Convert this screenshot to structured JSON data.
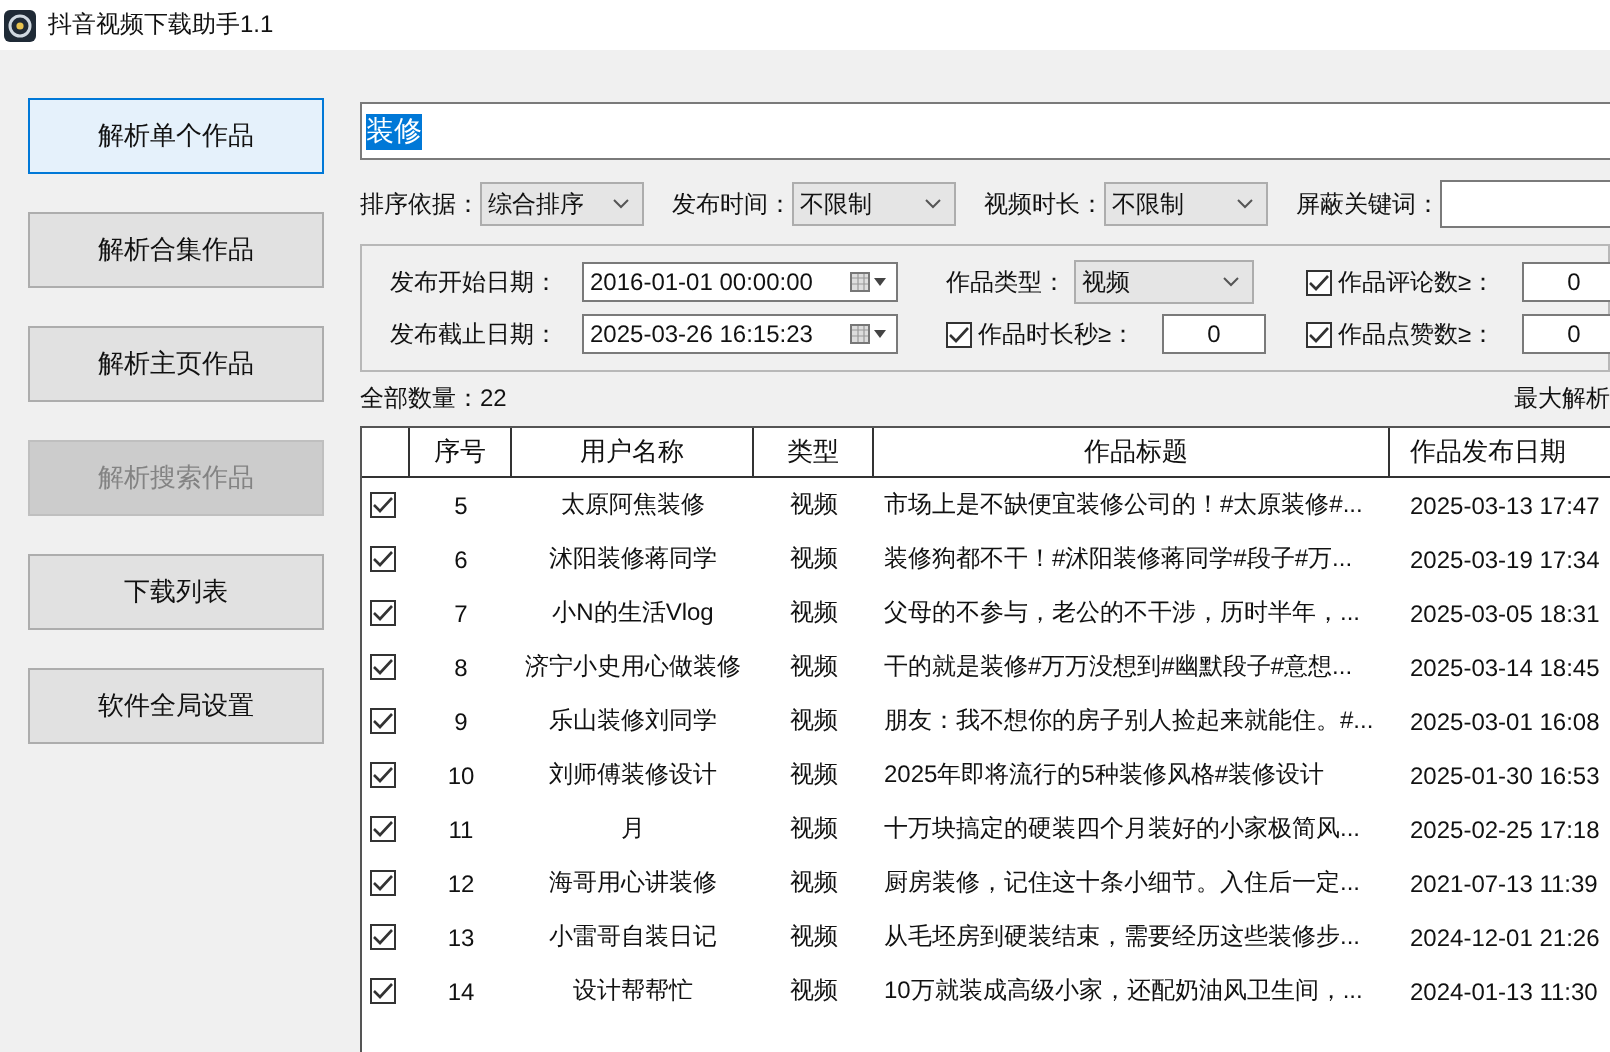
{
  "window": {
    "title": "抖音视频下载助手1.1"
  },
  "sidebar": {
    "items": [
      {
        "label": "解析单个作品",
        "selected": true,
        "disabled": false
      },
      {
        "label": "解析合集作品",
        "selected": false,
        "disabled": false
      },
      {
        "label": "解析主页作品",
        "selected": false,
        "disabled": false
      },
      {
        "label": "解析搜索作品",
        "selected": false,
        "disabled": true
      },
      {
        "label": "下载列表",
        "selected": false,
        "disabled": false
      },
      {
        "label": "软件全局设置",
        "selected": false,
        "disabled": false
      }
    ]
  },
  "search": {
    "value": "装修"
  },
  "filters": [
    {
      "label": "排序依据：",
      "value": "综合排序"
    },
    {
      "label": "发布时间：",
      "value": "不限制"
    },
    {
      "label": "视频时长：",
      "value": "不限制"
    }
  ],
  "blocked_keywords": {
    "label": "屏蔽关键词："
  },
  "date_range": {
    "start": {
      "label": "发布开始日期：",
      "value": "2016-01-01 00:00:00"
    },
    "end": {
      "label": "发布截止日期：",
      "value": "2025-03-26 16:15:23"
    }
  },
  "work_type": {
    "label": "作品类型：",
    "value": "视频"
  },
  "thresholds": [
    {
      "label": "作品评论数≥：",
      "checked": true,
      "value": "0"
    },
    {
      "label": "作品时长秒≥：",
      "checked": true,
      "value": "0"
    },
    {
      "label": "作品点赞数≥：",
      "checked": true,
      "value": "0"
    }
  ],
  "total": "全部数量：22",
  "max_parse": "最大解析",
  "table": {
    "columns": [
      "序号",
      "用户名称",
      "类型",
      "作品标题",
      "作品发布日期"
    ],
    "rows": [
      {
        "checked": true,
        "cells": [
          "5",
          "太原阿焦装修",
          "视频",
          "市场上是不缺便宜装修公司的！#太原装修#...",
          "2025-03-13 17:47"
        ]
      },
      {
        "checked": true,
        "cells": [
          "6",
          "沭阳装修蒋同学",
          "视频",
          "装修狗都不干！#沭阳装修蒋同学#段子#万...",
          "2025-03-19 17:34"
        ]
      },
      {
        "checked": true,
        "cells": [
          "7",
          "小N的生活Vlog",
          "视频",
          "父母的不参与，老公的不干涉，历时半年，...",
          "2025-03-05 18:31"
        ]
      },
      {
        "checked": true,
        "cells": [
          "8",
          "济宁小史用心做装修",
          "视频",
          "干的就是装修#万万没想到#幽默段子#意想...",
          "2025-03-14 18:45"
        ]
      },
      {
        "checked": true,
        "cells": [
          "9",
          "乐山装修刘同学",
          "视频",
          "朋友：我不想你的房子别人捡起来就能住。#...",
          "2025-03-01 16:08"
        ]
      },
      {
        "checked": true,
        "cells": [
          "10",
          "刘师傅装修设计",
          "视频",
          "2025年即将流行的5种装修风格#装修设计",
          "2025-01-30 16:53"
        ]
      },
      {
        "checked": true,
        "cells": [
          "11",
          "月",
          "视频",
          "十万块搞定的硬装四个月装好的小家极简风...",
          "2025-02-25 17:18"
        ]
      },
      {
        "checked": true,
        "cells": [
          "12",
          "海哥用心讲装修",
          "视频",
          "厨房装修，记住这十条小细节。入住后一定...",
          "2021-07-13 11:39"
        ]
      },
      {
        "checked": true,
        "cells": [
          "13",
          "小雷哥自装日记",
          "视频",
          "从毛坯房到硬装结束，需要经历这些装修步...",
          "2024-12-01 21:26"
        ]
      },
      {
        "checked": true,
        "cells": [
          "14",
          "设计帮帮忙",
          "视频",
          "10万就装成高级小家，还配奶油风卫生间，...",
          "2024-01-13 11:30"
        ]
      }
    ]
  }
}
